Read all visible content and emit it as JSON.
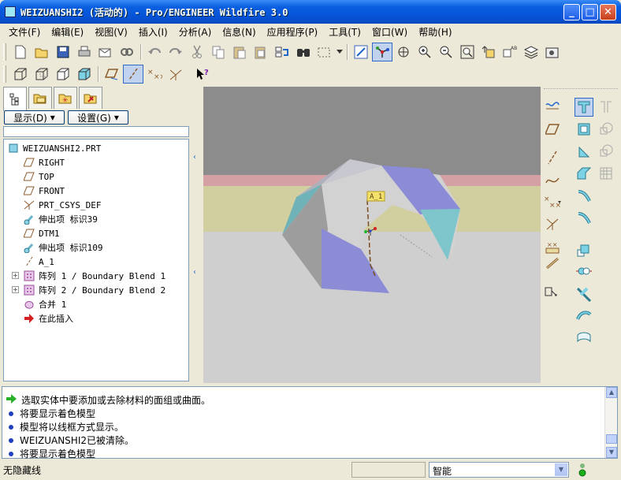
{
  "window": {
    "title": "WEIZUANSHI2 (活动的) - Pro/ENGINEER Wildfire 3.0",
    "minimize": "_",
    "maximize": "□",
    "close": "✕"
  },
  "menu": [
    "文件(F)",
    "编辑(E)",
    "视图(V)",
    "插入(I)",
    "分析(A)",
    "信息(N)",
    "应用程序(P)",
    "工具(T)",
    "窗口(W)",
    "帮助(H)"
  ],
  "toolbar1": [
    "new-icon",
    "open-icon",
    "save-icon",
    "print-icon",
    "send-mail-icon",
    "chain-icon",
    "undo-icon",
    "redo-icon",
    "cut-icon",
    "copy-icon",
    "paste-icon",
    "paste-special-icon",
    "regenerate-icon",
    "find-icon",
    "select-box-icon",
    "repaint-icon",
    "spin-center-icon",
    "orient-icon",
    "zoom-in-icon",
    "zoom-out-icon",
    "refit-icon",
    "reorient-icon",
    "saved-views-icon",
    "layers-icon",
    "view-manager-icon"
  ],
  "toolbar2": [
    "wireframe-icon",
    "hidden-line-icon",
    "no-hidden-icon",
    "shading-icon",
    "datum-planes-icon",
    "datum-axes-icon",
    "datum-points-icon",
    "csys-icon",
    "whats-this-icon"
  ],
  "left_panel": {
    "tabs": [
      "model-tree-tab",
      "folder-browser-tab",
      "favorites-tab",
      "connections-tab"
    ],
    "display_btn": "显示(D)",
    "settings_btn": "设置(G)",
    "tree": [
      {
        "label": "WEIZUANSHI2.PRT",
        "icon": "part-icon",
        "indent": 0,
        "expander": false
      },
      {
        "label": "RIGHT",
        "icon": "datum-plane-icon",
        "indent": 1,
        "expander": false
      },
      {
        "label": "TOP",
        "icon": "datum-plane-icon",
        "indent": 1,
        "expander": false
      },
      {
        "label": "FRONT",
        "icon": "datum-plane-icon",
        "indent": 1,
        "expander": false
      },
      {
        "label": "PRT_CSYS_DEF",
        "icon": "csys-icon",
        "indent": 1,
        "expander": false
      },
      {
        "label": "伸出项 标识39",
        "icon": "protrusion-icon",
        "indent": 1,
        "expander": false
      },
      {
        "label": "DTM1",
        "icon": "datum-plane-icon",
        "indent": 1,
        "expander": false
      },
      {
        "label": "伸出项 标识109",
        "icon": "protrusion-icon",
        "indent": 1,
        "expander": false
      },
      {
        "label": "A_1",
        "icon": "datum-axis-icon",
        "indent": 1,
        "expander": false
      },
      {
        "label": "阵列 1 / Boundary Blend 1",
        "icon": "pattern-icon",
        "indent": 1,
        "expander": true
      },
      {
        "label": "阵列 2 / Boundary Blend 2",
        "icon": "pattern-icon",
        "indent": 1,
        "expander": true
      },
      {
        "label": "合并 1",
        "icon": "merge-icon",
        "indent": 1,
        "expander": false
      },
      {
        "label": "在此插入",
        "icon": "insert-here-icon",
        "indent": 1,
        "expander": false
      }
    ]
  },
  "viewport": {
    "axis_label": "A_1"
  },
  "right_toolbar": [
    "sketch-curve-icon",
    "datum-plane-icon",
    "datum-axis-icon",
    "datum-curve-icon",
    "datum-point-icon",
    "csys-icon",
    "analysis-icon",
    "pattern-icon",
    "hole-icon",
    "shell-icon",
    "rib-icon",
    "draft-icon",
    "round-icon",
    "chamfer-icon",
    "extrude-icon",
    "revolve-icon",
    "variable-sweep-icon",
    "blend-icon",
    "boundary-blend-icon",
    "style-icon",
    "mirror-icon",
    "merge-icon",
    "trim-icon",
    "offset-icon",
    "thicken-icon",
    "solidify-icon"
  ],
  "messages": [
    {
      "type": "prompt",
      "text": "选取实体中要添加或去除材料的面组或曲面。"
    },
    {
      "type": "info",
      "text": "将要显示着色模型"
    },
    {
      "type": "info",
      "text": "模型将以线框方式显示。"
    },
    {
      "type": "info",
      "text": "WEIZUANSHI2已被清除。"
    },
    {
      "type": "info",
      "text": "将要显示着色模型"
    }
  ],
  "status": {
    "text": "无隐藏线",
    "filter": "智能"
  },
  "colors": {
    "title_bar": "#0653d6",
    "viewport_top": "#8c8c8c",
    "surface_blue": "#9c9ce0",
    "surface_teal": "#7ab8b8"
  }
}
